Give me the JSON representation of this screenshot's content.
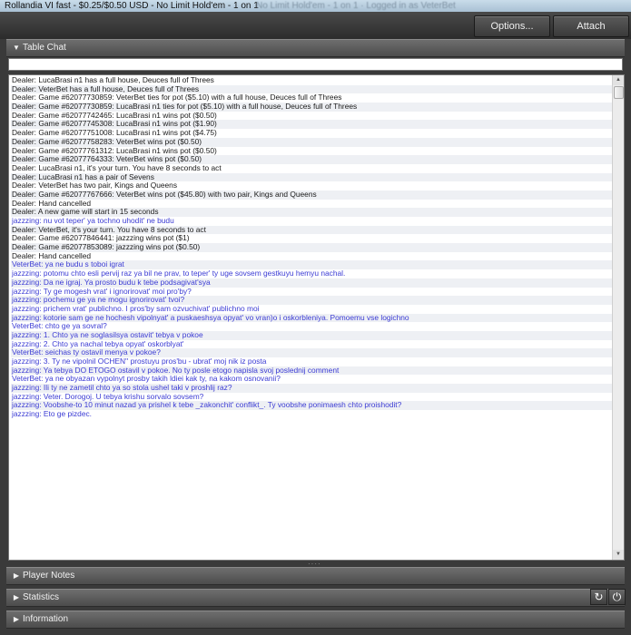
{
  "window": {
    "title": "Rollandia VI fast - $0.25/$0.50 USD - No Limit Hold'em - 1 on 1",
    "faded_title": "No Limit Hold'em - 1 on 1 · Logged in as VeterBet"
  },
  "toolbar": {
    "options_label": "Options...",
    "attach_label": "Attach"
  },
  "sections": {
    "table_chat": "Table Chat",
    "player_notes": "Player Notes",
    "statistics": "Statistics",
    "information": "Information"
  },
  "chat_input": {
    "value": ""
  },
  "colors": {
    "dealer": "#1a1a1a",
    "player": "#3b3bd4"
  },
  "icons": {
    "expanded_arrow": "▼",
    "collapsed_arrow": "▶",
    "refresh": "↻",
    "power": "⏻"
  },
  "chat": [
    {
      "type": "dealer",
      "text": "Dealer: LucaBrasi n1 has a full house, Deuces full of Threes"
    },
    {
      "type": "dealer",
      "text": "Dealer: VeterBet has a full house, Deuces full of Threes"
    },
    {
      "type": "dealer",
      "text": "Dealer: Game #62077730859: VeterBet ties for pot ($5.10) with a full house, Deuces full of Threes"
    },
    {
      "type": "dealer",
      "text": "Dealer: Game #62077730859: LucaBrasi n1 ties for pot ($5.10) with a full house, Deuces full of Threes"
    },
    {
      "type": "dealer",
      "text": "Dealer: Game #62077742465: LucaBrasi n1 wins pot ($0.50)"
    },
    {
      "type": "dealer",
      "text": "Dealer: Game #62077745308: LucaBrasi n1 wins pot ($1.90)"
    },
    {
      "type": "dealer",
      "text": "Dealer: Game #62077751008: LucaBrasi n1 wins pot ($4.75)"
    },
    {
      "type": "dealer",
      "text": "Dealer: Game #62077758283: VeterBet wins pot ($0.50)"
    },
    {
      "type": "dealer",
      "text": "Dealer: Game #62077761312: LucaBrasi n1 wins pot ($0.50)"
    },
    {
      "type": "dealer",
      "text": "Dealer: Game #62077764333: VeterBet wins pot ($0.50)"
    },
    {
      "type": "dealer",
      "text": "Dealer: LucaBrasi n1, it's your turn. You have 8 seconds to act"
    },
    {
      "type": "dealer",
      "text": "Dealer: LucaBrasi n1 has a pair of Sevens"
    },
    {
      "type": "dealer",
      "text": "Dealer: VeterBet has two pair, Kings and Queens"
    },
    {
      "type": "dealer",
      "text": "Dealer: Game #62077767666: VeterBet wins pot ($45.80) with two pair, Kings and Queens"
    },
    {
      "type": "dealer",
      "text": "Dealer: Hand cancelled"
    },
    {
      "type": "dealer",
      "text": "Dealer: A new game will start in 15 seconds"
    },
    {
      "type": "player",
      "text": "jazzzing: nu vot teper' ya tochno uhodit' ne budu"
    },
    {
      "type": "dealer",
      "text": "Dealer: VeterBet, it's your turn. You have 8 seconds to act"
    },
    {
      "type": "dealer",
      "text": "Dealer: Game #62077846441: jazzzing wins pot ($1)"
    },
    {
      "type": "dealer",
      "text": "Dealer: Game #62077853089: jazzzing wins pot ($0.50)"
    },
    {
      "type": "dealer",
      "text": "Dealer: Hand cancelled"
    },
    {
      "type": "player",
      "text": "VeterBet: ya ne budu s toboi igrat"
    },
    {
      "type": "player",
      "text": "jazzzing: potomu chto esli pervij raz ya bil ne prav, to teper' ty uge sovsem gestkuyu hemyu nachal."
    },
    {
      "type": "player",
      "text": "jazzzing: Da ne igraj. Ya prosto budu k tebe podsagivat'sya"
    },
    {
      "type": "player",
      "text": "jazzzing: Ty ge mogesh vrat' i ignorirovat' moi pro'by?"
    },
    {
      "type": "player",
      "text": "jazzzing: pochemu ge ya ne mogu ignorirovat' tvoi?"
    },
    {
      "type": "player",
      "text": "jazzzing: prichem vrat' publichno. I pros'by sam ozvuchivat' publichno moi"
    },
    {
      "type": "player",
      "text": "jazzzing: kotorie sam ge ne hochesh vipolnyat' a puskaeshsya opyat' vo vran)o i oskorbleniya. Pomoemu vse logichno"
    },
    {
      "type": "player",
      "text": "VeterBet: chto ge ya sovral?"
    },
    {
      "type": "player",
      "text": "jazzzing: 1. Chto ya ne soglasilsya ostavit' tebya v pokoe"
    },
    {
      "type": "player",
      "text": "jazzzing: 2. Chto ya nachal tebya opyat' oskorblyat'"
    },
    {
      "type": "player",
      "text": "VeterBet: seichas ty ostavil menya v pokoe?"
    },
    {
      "type": "player",
      "text": "jazzzing: 3. Ty ne vipolnil OCHEN'' prostuyu pros'bu - ubrat' moj nik iz posta"
    },
    {
      "type": "player",
      "text": "jazzzing: Ya tebya DO ETOGO ostavil v pokoe. No ty posle etogo napisla svoj poslednij comment"
    },
    {
      "type": "player",
      "text": "VeterBet: ya ne obyazan vypolnyt prosby takih ldiei kak ty, na kakom osnovanii?"
    },
    {
      "type": "player",
      "text": "jazzzing: Ili ty ne zametil chto ya so stola ushel taki v proshlij raz?"
    },
    {
      "type": "player",
      "text": "jazzzing: Veter. Dorogoj. U tebya krishu sorvalo sovsem?"
    },
    {
      "type": "player",
      "text": "jazzzing: Voobshe-to 10 minut nazad ya prishel k tebe _zakonchit' conflikt_. Ty voobshe ponimaesh chto proishodit?"
    },
    {
      "type": "player",
      "text": "jazzzing: Eto ge pizdec."
    }
  ]
}
